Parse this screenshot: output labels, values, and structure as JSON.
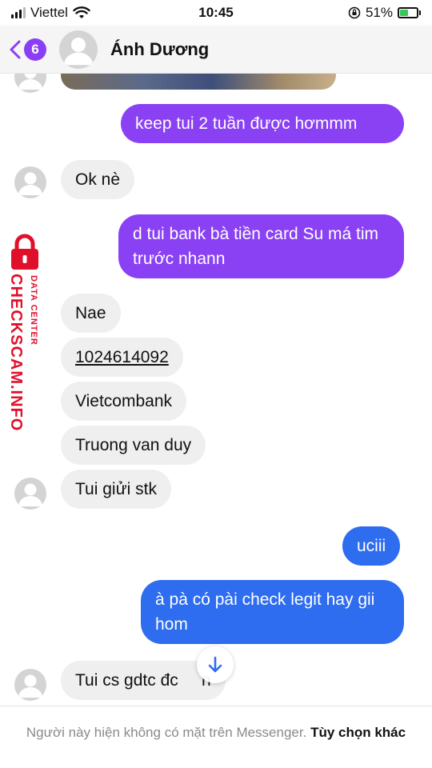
{
  "status_bar": {
    "carrier": "Viettel",
    "time": "10:45",
    "battery": "51%"
  },
  "header": {
    "unread_count": "6",
    "contact_name": "Ánh Dương"
  },
  "messages": [
    {
      "text": "keep tui 2 tuần được hơmmm"
    },
    {
      "text": "Ok nè"
    },
    {
      "text": "d tui bank bà tiền card Su má tim trước nhann"
    },
    {
      "text": "Nae"
    },
    {
      "text": "1024614092"
    },
    {
      "text": "Vietcombank"
    },
    {
      "text": "Truong van duy"
    },
    {
      "text": "Tui giửi stk"
    },
    {
      "text": "uciii"
    },
    {
      "text": "à pà có pài check legit hay gii hom"
    },
    {
      "text": "Tui cs gdtc đc     n"
    }
  ],
  "footer": {
    "status_text": "Người này hiện không có mặt trên Messenger.",
    "link_text": "Tùy chọn khác"
  },
  "watermark": {
    "main": "CHECKSCAM.INFO",
    "sub": "DATA CENTER"
  },
  "colors": {
    "accent_purple": "#8a41f4",
    "accent_blue": "#2e6cf0",
    "incoming_bubble": "#efefef",
    "watermark_red": "#e0102a",
    "battery_green": "#35c759"
  },
  "icons": [
    "signal-icon",
    "wifi-icon",
    "orientation-lock-icon",
    "battery-icon",
    "back-chevron-icon",
    "person-icon",
    "scroll-down-arrow-icon",
    "lock-icon"
  ]
}
